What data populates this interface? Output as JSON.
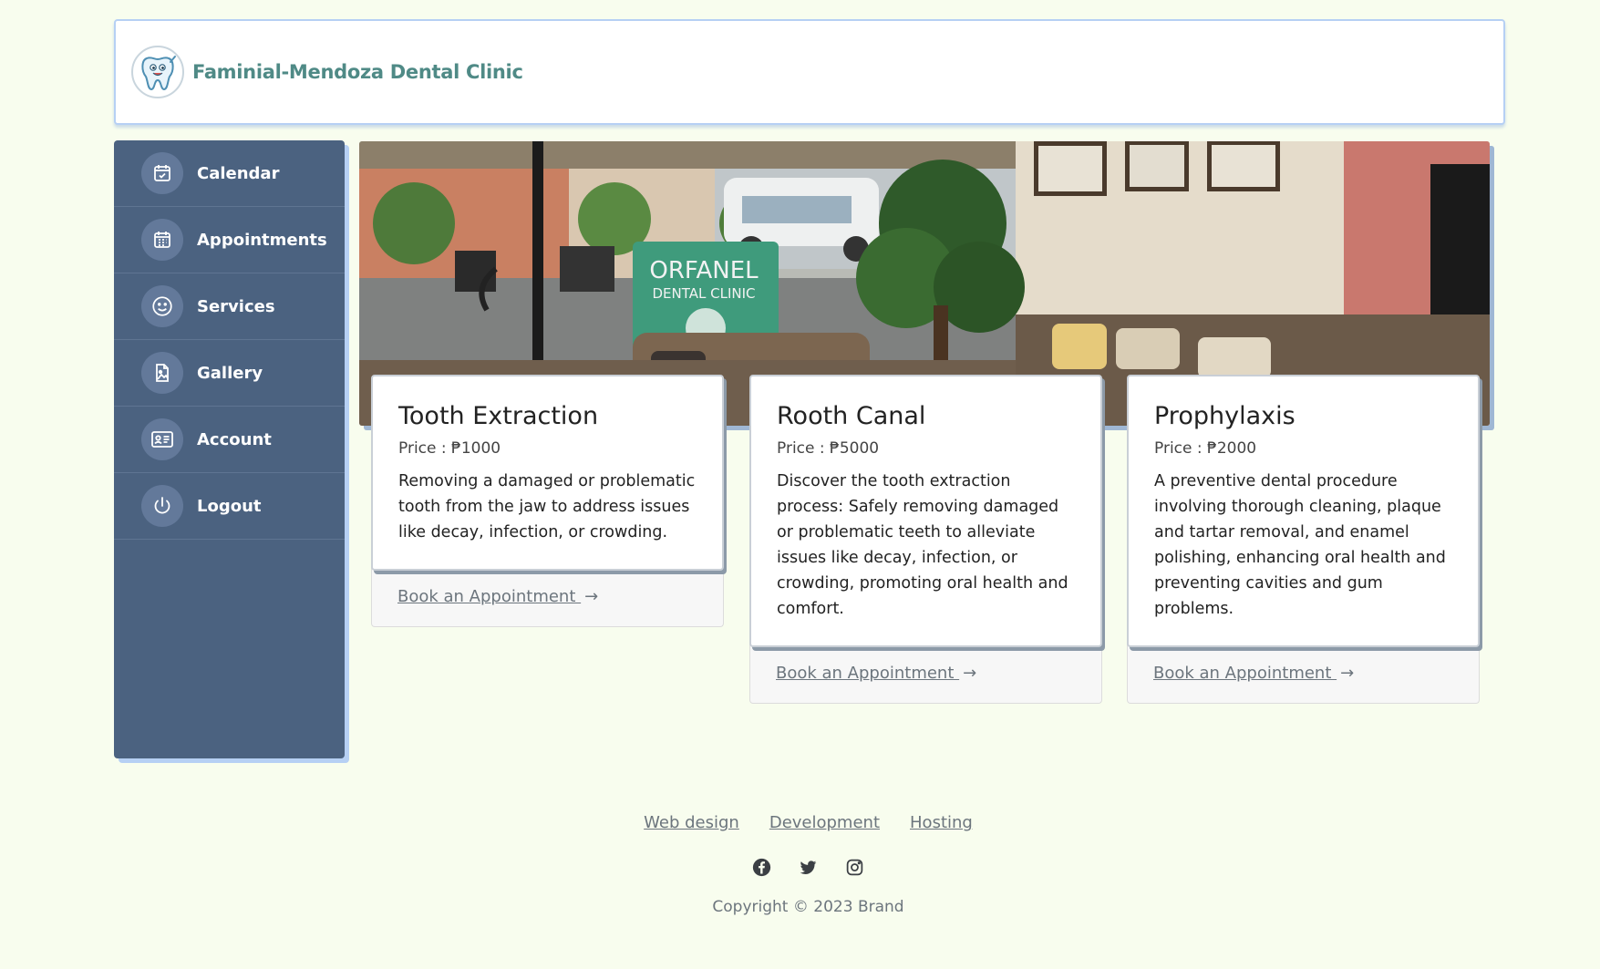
{
  "header": {
    "brand_name": "Faminial-Mendoza Dental Clinic",
    "logo_icon": "tooth-mascot-icon"
  },
  "sidebar": {
    "items": [
      {
        "label": "Calendar",
        "icon": "calendar-check-icon"
      },
      {
        "label": "Appointments",
        "icon": "calendar-grid-icon"
      },
      {
        "label": "Services",
        "icon": "smiley-icon"
      },
      {
        "label": "Gallery",
        "icon": "image-file-icon"
      },
      {
        "label": "Account",
        "icon": "id-card-icon"
      },
      {
        "label": "Logout",
        "icon": "power-icon"
      }
    ]
  },
  "banner": {
    "sign_line1": "ORFANEL",
    "sign_line2": "DENTAL CLINIC"
  },
  "services": [
    {
      "title": "Tooth Extraction",
      "price": "Price : ₱1000",
      "description": "Removing a damaged or problematic tooth from the jaw to address issues like decay, infection, or crowding.",
      "cta": "Book an Appointment "
    },
    {
      "title": "Rooth Canal",
      "price": "Price : ₱5000",
      "description": "Discover the tooth extraction process: Safely removing damaged or problematic teeth to alleviate issues like decay, infection, or crowding, promoting oral health and comfort.",
      "cta": "Book an Appointment "
    },
    {
      "title": "Prophylaxis",
      "price": "Price : ₱2000",
      "description": "A preventive dental procedure involving thorough cleaning, plaque and tartar removal, and enamel polishing, enhancing oral health and preventing cavities and gum problems.",
      "cta": "Book an Appointment "
    }
  ],
  "footer": {
    "links": [
      "Web design",
      "Development",
      "Hosting"
    ],
    "social_icons": [
      "facebook-icon",
      "twitter-icon",
      "instagram-icon"
    ],
    "copyright": "Copyright © 2023 Brand"
  },
  "colors": {
    "page_background": "#f8fdee",
    "sidebar": "#4b6280",
    "brand_text": "#4f8a86",
    "accent_border": "#b6d0f4"
  }
}
